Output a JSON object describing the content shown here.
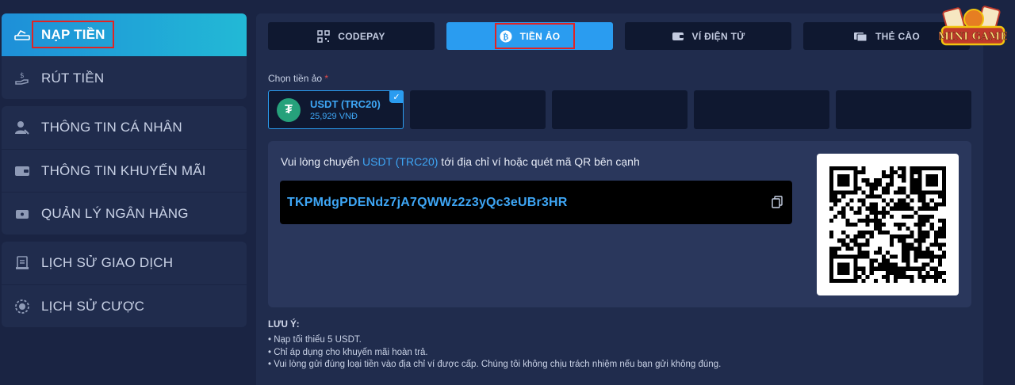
{
  "sidebar": {
    "groups": [
      [
        {
          "label": "NẠP TIỀN",
          "icon": "deposit-icon",
          "active": true
        },
        {
          "label": "RÚT TIỀN",
          "icon": "withdraw-icon"
        }
      ],
      [
        {
          "label": "THÔNG TIN CÁ NHÂN",
          "icon": "user-icon"
        },
        {
          "label": "THÔNG TIN KHUYẾN MÃI",
          "icon": "wallet-icon"
        },
        {
          "label": "QUẢN LÝ NGÂN HÀNG",
          "icon": "bank-card-icon"
        }
      ],
      [
        {
          "label": "LỊCH SỬ GIAO DỊCH",
          "icon": "receipt-icon"
        },
        {
          "label": "LỊCH SỬ CƯỢC",
          "icon": "chip-icon"
        }
      ]
    ]
  },
  "tabs": [
    {
      "label": "CODEPAY",
      "icon": "qr-icon"
    },
    {
      "label": "TIỀN ẢO",
      "icon": "bitcoin-icon",
      "active": true
    },
    {
      "label": "VÍ ĐIỆN TỬ",
      "icon": "e-wallet-icon"
    },
    {
      "label": "THẺ CÀO",
      "icon": "card-icon"
    }
  ],
  "crypto": {
    "select_label": "Chọn tiền ảo",
    "required_mark": "*",
    "selected_coin": {
      "name": "USDT (TRC20)",
      "rate": "25,929 VNĐ"
    }
  },
  "transfer": {
    "instruction_prefix": "Vui lòng chuyển ",
    "instruction_coin": "USDT (TRC20)",
    "instruction_suffix": " tới địa chỉ ví hoặc quét mã QR bên cạnh",
    "address": "TKPMdgPDENdz7jA7QWWz2z3yQc3eUBr3HR"
  },
  "notes": {
    "title": "LƯU Ý:",
    "items": [
      "Nạp tối thiểu 5 USDT.",
      "Chỉ áp dụng cho khuyến mãi hoàn trả.",
      "Vui lòng gửi đúng loại tiền vào địa chỉ ví được cấp. Chúng tôi không chịu trách nhiệm nếu bạn gửi không đúng."
    ]
  },
  "logo": {
    "text": "MINI GAME"
  },
  "colors": {
    "accent": "#2a9cf0",
    "highlight": "#e02424",
    "tether": "#26a17b"
  }
}
